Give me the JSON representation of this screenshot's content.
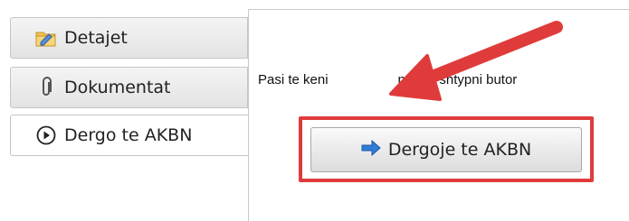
{
  "tabs": [
    {
      "label": "Detajet",
      "icon": "folder-pencil-icon"
    },
    {
      "label": "Dokumentat",
      "icon": "paperclip-icon"
    },
    {
      "label": "Dergo te AKBN",
      "icon": "play-circle-icon"
    }
  ],
  "content": {
    "instruction_visible": "Pasi te keni",
    "instruction_visible_2": "nduar, shtypni butor",
    "send_button_label": "Dergoje te AKBN",
    "send_button_icon": "arrow-right-icon"
  },
  "colors": {
    "annotation_red": "#e03b3b",
    "arrow_blue": "#2f7bd6"
  }
}
